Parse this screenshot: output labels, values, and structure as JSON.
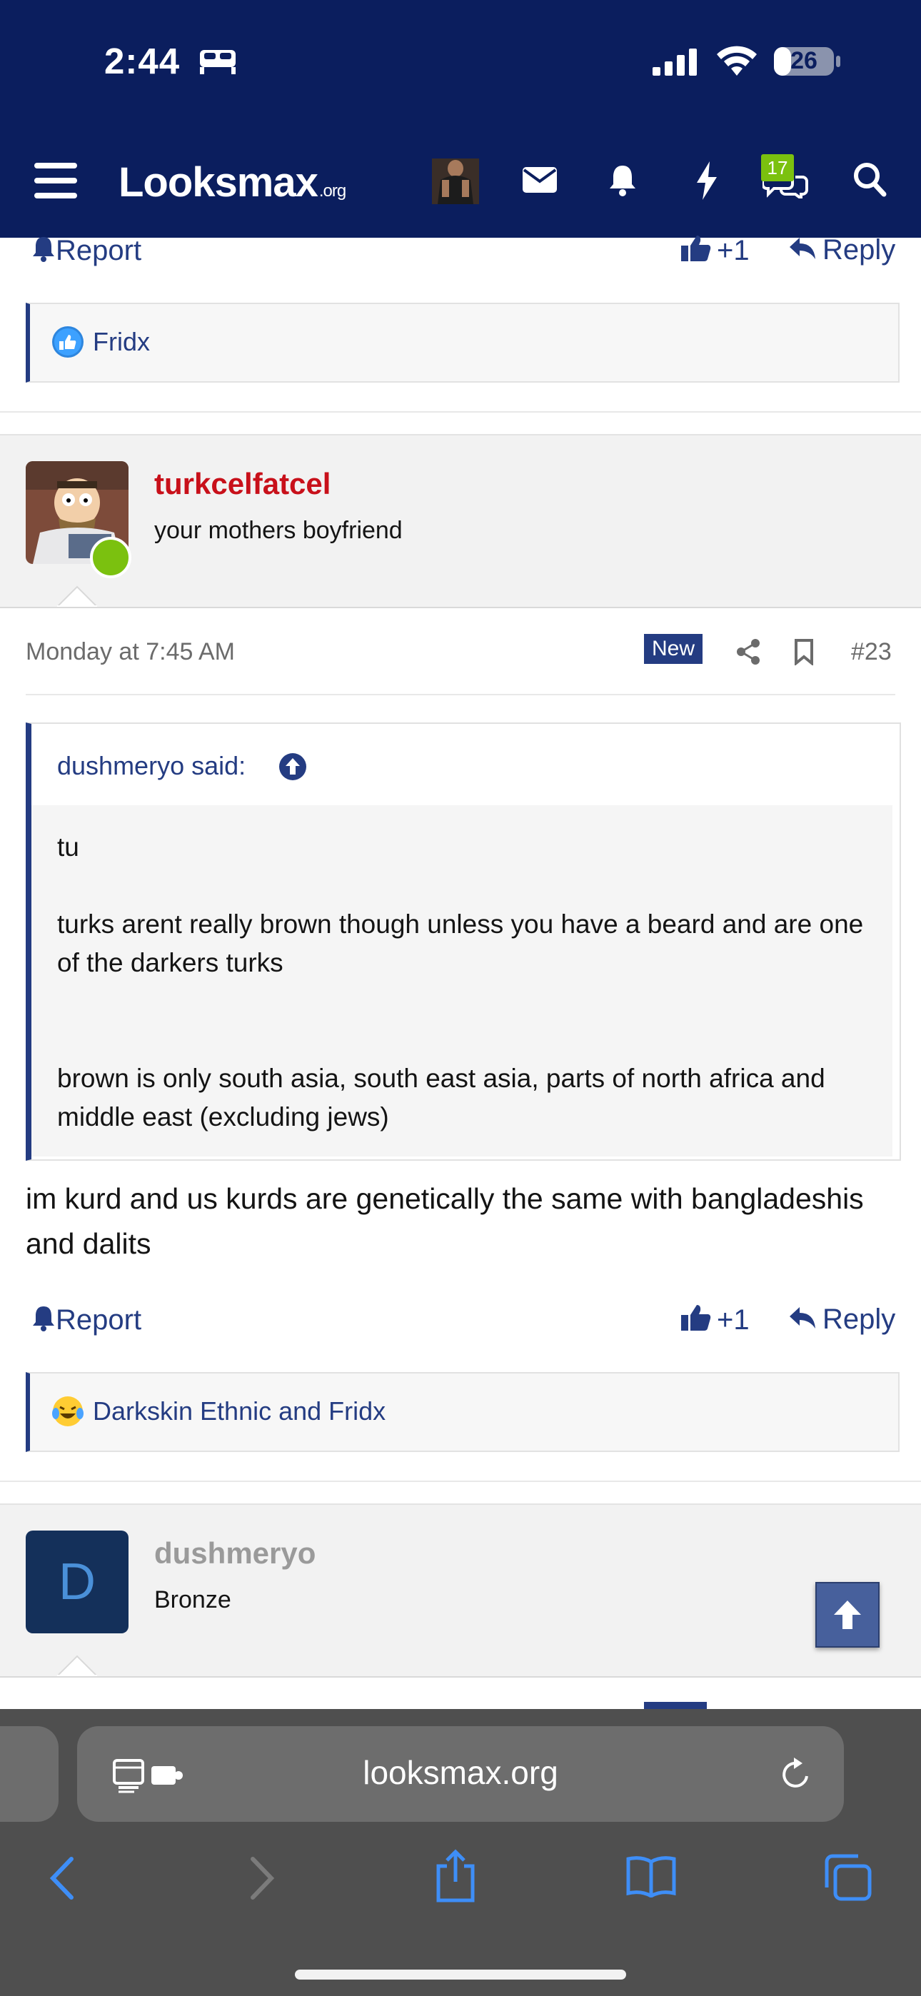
{
  "status_bar": {
    "time": "2:44",
    "battery": "26"
  },
  "header": {
    "logo_main": "Looksmax",
    "logo_suffix": ".org",
    "chat_badge": "17"
  },
  "post_top": {
    "report": "Report",
    "like_count": "+1",
    "reply": "Reply",
    "reactions": "Fridx"
  },
  "post": {
    "username": "turkcelfatcel",
    "user_title": "your mothers boyfriend",
    "timestamp": "Monday at 7:45 AM",
    "new_badge": "New",
    "post_number": "#23",
    "quote_author": "dushmeryo said:",
    "quote_lines": [
      "tu",
      "turks arent really brown though unless you have a beard and are one of the darkers turks",
      "brown is only south asia, south east asia, parts of north africa and middle east (excluding jews)"
    ],
    "message": "im kurd and us kurds are genetically the same with bangladeshis and dalits",
    "report": "Report",
    "like_count": "+1",
    "reply": "Reply",
    "reactions": "Darkskin Ethnic and Fridx"
  },
  "next_post": {
    "avatar_letter": "D",
    "username": "dushmeryo",
    "user_title": "Bronze"
  },
  "browser": {
    "url": "looksmax.org"
  },
  "colors": {
    "header_bg": "#0b1e5e",
    "link": "#243c82",
    "username_red": "#c8101a",
    "online_green": "#7bc10f",
    "avatar_d_bg": "#14305a"
  }
}
